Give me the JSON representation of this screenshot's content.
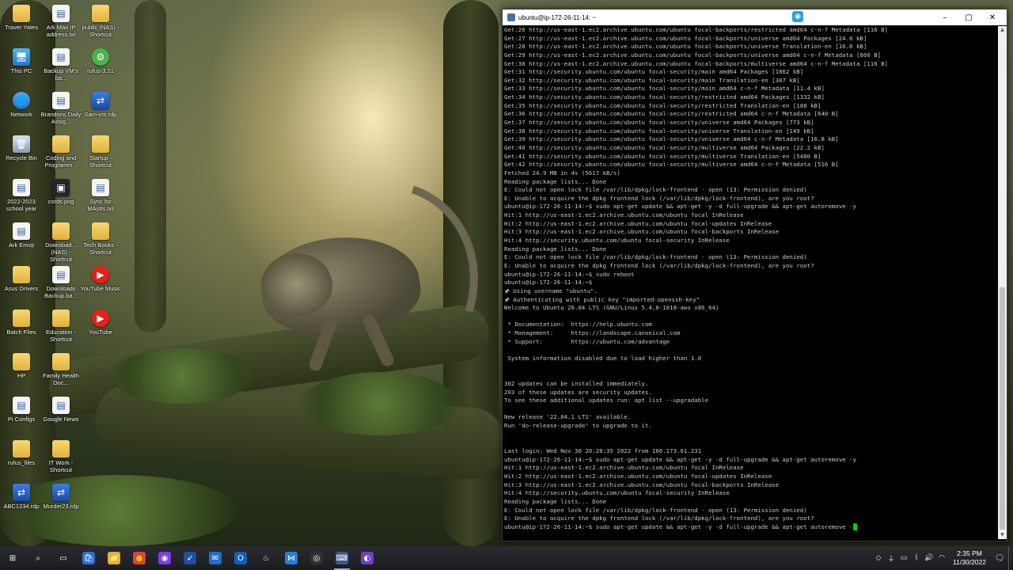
{
  "desktop_icons": [
    {
      "label": "Traver Yates",
      "icon": "folder-icon",
      "kind": "g-folder",
      "glyph": "",
      "col": 0,
      "row": 0
    },
    {
      "label": "This PC",
      "icon": "computer-icon",
      "kind": "g-pc",
      "glyph": "🖥",
      "col": 0,
      "row": 1
    },
    {
      "label": "Network",
      "icon": "network-icon",
      "kind": "g-net",
      "glyph": "🌐",
      "col": 0,
      "row": 2
    },
    {
      "label": "Recycle Bin",
      "icon": "recycle-bin-icon",
      "kind": "g-bin",
      "glyph": "🗑",
      "col": 0,
      "row": 3
    },
    {
      "label": "2022-2023 school year",
      "icon": "document-icon",
      "kind": "g-doc",
      "glyph": "▤",
      "col": 0,
      "row": 4
    },
    {
      "label": "Ark Emoji",
      "icon": "document-icon",
      "kind": "g-doc",
      "glyph": "▤",
      "col": 0,
      "row": 5
    },
    {
      "label": "Asus Drivers",
      "icon": "folder-icon",
      "kind": "g-folder",
      "glyph": "",
      "col": 0,
      "row": 6
    },
    {
      "label": "Batch Files",
      "icon": "folder-icon",
      "kind": "g-folder",
      "glyph": "",
      "col": 0,
      "row": 7
    },
    {
      "label": "HP",
      "icon": "folder-icon",
      "kind": "g-folder",
      "glyph": "",
      "col": 0,
      "row": 8
    },
    {
      "label": "Pi Configs",
      "icon": "document-icon",
      "kind": "g-doc",
      "glyph": "▤",
      "col": 0,
      "row": 9
    },
    {
      "label": "rufus_files",
      "icon": "folder-icon",
      "kind": "g-folder",
      "glyph": "",
      "col": 0,
      "row": 10
    },
    {
      "label": "ABC1234.rdp",
      "icon": "remote-desktop-icon",
      "kind": "g-rdp",
      "glyph": "⇄",
      "col": 0,
      "row": 11
    },
    {
      "label": "Ark Mao IP address.txt",
      "icon": "text-file-icon",
      "kind": "g-doc",
      "glyph": "▤",
      "col": 1,
      "row": 0
    },
    {
      "label": "Backup VM's ba...",
      "icon": "document-icon",
      "kind": "g-doc",
      "glyph": "▤",
      "col": 1,
      "row": 1
    },
    {
      "label": "Brandons Daily Assig...",
      "icon": "document-icon",
      "kind": "g-doc",
      "glyph": "▤",
      "col": 1,
      "row": 2
    },
    {
      "label": "Coding and Programm...",
      "icon": "folder-icon",
      "kind": "g-folder",
      "glyph": "",
      "col": 1,
      "row": 3
    },
    {
      "label": "cords.png",
      "icon": "image-icon",
      "kind": "g-dark",
      "glyph": "▣",
      "col": 1,
      "row": 4
    },
    {
      "label": "Download... (NAS) - Shortcut",
      "icon": "folder-icon",
      "kind": "g-folder",
      "glyph": "",
      "col": 1,
      "row": 5
    },
    {
      "label": "Downloads Backup.ba...",
      "icon": "document-icon",
      "kind": "g-doc",
      "glyph": "▤",
      "col": 1,
      "row": 6
    },
    {
      "label": "Education - Shortcut",
      "icon": "folder-icon",
      "kind": "g-folder",
      "glyph": "",
      "col": 1,
      "row": 7
    },
    {
      "label": "Family Health Doc...",
      "icon": "folder-icon",
      "kind": "g-folder",
      "glyph": "",
      "col": 1,
      "row": 8
    },
    {
      "label": "Google News",
      "icon": "document-icon",
      "kind": "g-doc",
      "glyph": "▤",
      "col": 1,
      "row": 9
    },
    {
      "label": "IT Work - Shortcut",
      "icon": "folder-icon",
      "kind": "g-folder",
      "glyph": "",
      "col": 1,
      "row": 10
    },
    {
      "label": "Murder23.rdp",
      "icon": "remote-desktop-icon",
      "kind": "g-rdp",
      "glyph": "⇄",
      "col": 1,
      "row": 11
    },
    {
      "label": "public (NAS) - Shortcut",
      "icon": "folder-icon",
      "kind": "g-folder",
      "glyph": "",
      "col": 2,
      "row": 0
    },
    {
      "label": "rufus-3.21",
      "icon": "usb-icon",
      "kind": "g-green",
      "glyph": "⚙",
      "col": 2,
      "row": 1
    },
    {
      "label": "Sam-vm.rdp",
      "icon": "remote-desktop-icon",
      "kind": "g-rdp",
      "glyph": "⇄",
      "col": 2,
      "row": 2
    },
    {
      "label": "Startup - Shortcut",
      "icon": "folder-icon",
      "kind": "g-folder",
      "glyph": "",
      "col": 2,
      "row": 3
    },
    {
      "label": "Sync for MAstts.txt",
      "icon": "text-file-icon",
      "kind": "g-doc",
      "glyph": "▤",
      "col": 2,
      "row": 4
    },
    {
      "label": "Tech Books - Shortcut",
      "icon": "folder-icon",
      "kind": "g-folder",
      "glyph": "",
      "col": 2,
      "row": 5
    },
    {
      "label": "YouTube Music",
      "icon": "youtube-music-icon",
      "kind": "g-yt",
      "glyph": "▶",
      "col": 2,
      "row": 6
    },
    {
      "label": "YouTube",
      "icon": "youtube-icon",
      "kind": "g-yt",
      "glyph": "▶",
      "col": 2,
      "row": 7
    }
  ],
  "terminal": {
    "title": "ubuntu@ip-172-26-11-14: ~",
    "lines": [
      "Get:26 http://us-east-1.ec2.archive.ubuntu.com/ubuntu focal-backports/restricted amd64 c-n-f Metadata [116 B]",
      "Get:27 http://us-east-1.ec2.archive.ubuntu.com/ubuntu focal-backports/universe amd64 Packages [24.0 kB]",
      "Get:28 http://us-east-1.ec2.archive.ubuntu.com/ubuntu focal-backports/universe Translation-en [16.0 kB]",
      "Get:29 http://us-east-1.ec2.archive.ubuntu.com/ubuntu focal-backports/universe amd64 c-n-f Metadata [860 B]",
      "Get:30 http://us-east-1.ec2.archive.ubuntu.com/ubuntu focal-backports/multiverse amd64 c-n-f Metadata [116 B]",
      "Get:31 http://security.ubuntu.com/ubuntu focal-security/main amd64 Packages [1862 kB]",
      "Get:32 http://security.ubuntu.com/ubuntu focal-security/main Translation-en [307 kB]",
      "Get:33 http://security.ubuntu.com/ubuntu focal-security/main amd64 c-n-f Metadata [11.4 kB]",
      "Get:34 http://security.ubuntu.com/ubuntu focal-security/restricted amd64 Packages [1332 kB]",
      "Get:35 http://security.ubuntu.com/ubuntu focal-security/restricted Translation-en [188 kB]",
      "Get:36 http://security.ubuntu.com/ubuntu focal-security/restricted amd64 c-n-f Metadata [640 B]",
      "Get:37 http://security.ubuntu.com/ubuntu focal-security/universe amd64 Packages [773 kB]",
      "Get:38 http://security.ubuntu.com/ubuntu focal-security/universe Translation-en [149 kB]",
      "Get:39 http://security.ubuntu.com/ubuntu focal-security/universe amd64 c-n-f Metadata [16.8 kB]",
      "Get:40 http://security.ubuntu.com/ubuntu focal-security/multiverse amd64 Packages [22.2 kB]",
      "Get:41 http://security.ubuntu.com/ubuntu focal-security/multiverse Translation-en [5400 B]",
      "Get:42 http://security.ubuntu.com/ubuntu focal-security/multiverse amd64 c-n-f Metadata [516 B]",
      "Fetched 24.9 MB in 4s (5617 kB/s)",
      "Reading package lists... Done",
      "E: Could not open lock file /var/lib/dpkg/lock-frontend - open (13: Permission denied)",
      "E: Unable to acquire the dpkg frontend lock (/var/lib/dpkg/lock-frontend), are you root?",
      "ubuntu@ip-172-26-11-14:~$ sudo apt-get update && apt-get -y -d full-upgrade && apt-get autoremove -y",
      "Hit:1 http://us-east-1.ec2.archive.ubuntu.com/ubuntu focal InRelease",
      "Hit:2 http://us-east-1.ec2.archive.ubuntu.com/ubuntu focal-updates InRelease",
      "Hit:3 http://us-east-1.ec2.archive.ubuntu.com/ubuntu focal-backports InRelease",
      "Hit:4 http://security.ubuntu.com/ubuntu focal-security InRelease",
      "Reading package lists... Done",
      "E: Could not open lock file /var/lib/dpkg/lock-frontend - open (13: Permission denied)",
      "E: Unable to acquire the dpkg frontend lock (/var/lib/dpkg/lock-frontend), are you root?",
      "ubuntu@ip-172-26-11-14:~$ sudo reboot",
      "ubuntu@ip-172-26-11-14:~$",
      "🖈 Using username \"ubuntu\".",
      "🖈 Authenticating with public key \"imported-openssh-key\"",
      "Welcome to Ubuntu 20.04 LTS (GNU/Linux 5.4.0-1018-aws x86_64)",
      "",
      " * Documentation:  https://help.ubuntu.com",
      " * Management:     https://landscape.canonical.com",
      " * Support:        https://ubuntu.com/advantage",
      "",
      " System information disabled due to load higher than 1.0",
      "",
      "",
      "302 updates can be installed immediately.",
      "203 of these updates are security updates.",
      "To see these additional updates run: apt list --upgradable",
      "",
      "New release '22.04.1 LTS' available.",
      "Run 'do-release-upgrade' to upgrade to it.",
      "",
      "",
      "Last login: Wed Nov 30 20:28:35 2022 from 166.173.61.231",
      "ubuntu@ip-172-26-11-14:~$ sudo apt-get update && apt-get -y -d full-upgrade && apt-get autoremove -y",
      "Hit:1 http://us-east-1.ec2.archive.ubuntu.com/ubuntu focal InRelease",
      "Hit:2 http://us-east-1.ec2.archive.ubuntu.com/ubuntu focal-updates InRelease",
      "Hit:3 http://us-east-1.ec2.archive.ubuntu.com/ubuntu focal-backports InRelease",
      "Hit:4 http://security.ubuntu.com/ubuntu focal-security InRelease",
      "Reading package lists... Done",
      "E: Could not open lock file /var/lib/dpkg/lock-frontend - open (13: Permission denied)",
      "E: Unable to acquire the dpkg frontend lock (/var/lib/dpkg/lock-frontend), are you root?"
    ],
    "current_input": "ubuntu@ip-172-26-11-14:~$ sudo apt-get update && apt-get -y -d full-upgrade && apt-get autoremove -"
  },
  "taskbar": {
    "apps": [
      {
        "name": "start-button",
        "glyph": "⊞",
        "color": "#ffffff",
        "bg": "transparent"
      },
      {
        "name": "search-icon",
        "glyph": "⌕",
        "color": "#ffffff",
        "bg": "transparent"
      },
      {
        "name": "task-view-icon",
        "glyph": "▭",
        "color": "#ffffff",
        "bg": "transparent"
      },
      {
        "name": "store-icon",
        "glyph": "🛍",
        "color": "#ffffff",
        "bg": "#2c6fd6"
      },
      {
        "name": "file-explorer-icon",
        "glyph": "📁",
        "color": "#ffffff",
        "bg": "#e2b23a"
      },
      {
        "name": "chrome-icon",
        "glyph": "●",
        "color": "#fbbc05",
        "bg": "#db4437"
      },
      {
        "name": "browser-icon",
        "glyph": "◉",
        "color": "#ffffff",
        "bg": "#7b3fe4"
      },
      {
        "name": "feather-icon",
        "glyph": "➶",
        "color": "#ffffff",
        "bg": "#1f4fa0"
      },
      {
        "name": "mail-icon",
        "glyph": "✉",
        "color": "#ffffff",
        "bg": "#1f6fcf"
      },
      {
        "name": "outlook-icon",
        "glyph": "O",
        "color": "#ffffff",
        "bg": "#0f5fb8"
      },
      {
        "name": "flame-icon",
        "glyph": "♨",
        "color": "#ffffff",
        "bg": "transparent"
      },
      {
        "name": "vscode-icon",
        "glyph": "⋈",
        "color": "#ffffff",
        "bg": "#2a7fd1"
      },
      {
        "name": "obs-icon",
        "glyph": "◎",
        "color": "#ffffff",
        "bg": "#303030"
      },
      {
        "name": "putty-icon",
        "glyph": "⌨",
        "color": "#ffffff",
        "bg": "#3b5a8a"
      },
      {
        "name": "github-icon",
        "glyph": "◐",
        "color": "#ffffff",
        "bg": "#6e40c9"
      }
    ],
    "tray_icons": [
      {
        "name": "dropbox-icon",
        "glyph": "◇"
      },
      {
        "name": "usb-icon",
        "glyph": "⏚"
      },
      {
        "name": "display-icon",
        "glyph": "▭"
      },
      {
        "name": "network-tray-icon",
        "glyph": "⌇"
      },
      {
        "name": "volume-icon",
        "glyph": "🔊"
      },
      {
        "name": "wifi-icon",
        "glyph": "◠"
      }
    ],
    "clock_time": "2:35 PM",
    "clock_date": "11/30/2022"
  }
}
